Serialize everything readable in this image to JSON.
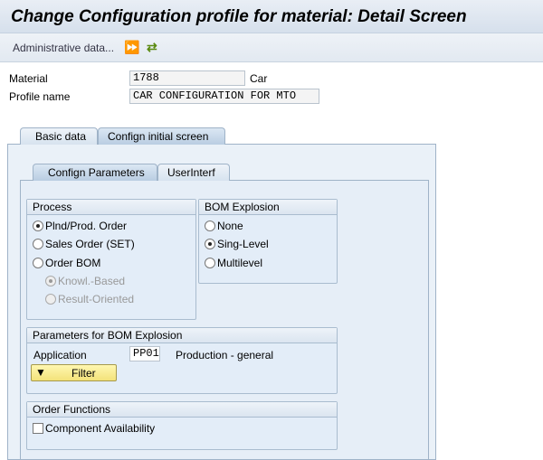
{
  "title": "Change Configuration profile for material: Detail Screen",
  "toolbar": {
    "admin_label": "Administrative data...",
    "icons": [
      "execute-icon",
      "switch-icon"
    ]
  },
  "header": {
    "material_label": "Material",
    "material_value": "1788",
    "material_desc": "Car",
    "profile_label": "Profile name",
    "profile_value": "CAR CONFIGURATION FOR MTO"
  },
  "tabs": [
    {
      "label": "Basic data",
      "active": false
    },
    {
      "label": "Confign initial screen",
      "active": true
    }
  ],
  "subtabs": [
    {
      "label": "Confign Parameters",
      "active": true
    },
    {
      "label": "UserInterf",
      "active": false
    }
  ],
  "process": {
    "title": "Process",
    "options": [
      {
        "label": "Plnd/Prod. Order",
        "selected": true
      },
      {
        "label": "Sales Order (SET)",
        "selected": false
      },
      {
        "label": "Order BOM",
        "selected": false
      },
      {
        "label": "Knowl.-Based",
        "selected": true,
        "disabled": true
      },
      {
        "label": "Result-Oriented",
        "selected": false,
        "disabled": true
      }
    ]
  },
  "bom": {
    "title": "BOM Explosion",
    "options": [
      {
        "label": "None",
        "selected": false
      },
      {
        "label": "Sing-Level",
        "selected": true
      },
      {
        "label": "Multilevel",
        "selected": false
      }
    ]
  },
  "params": {
    "title": "Parameters for BOM Explosion",
    "application_label": "Application",
    "application_value": "PP01",
    "application_desc": "Production - general",
    "filter_label": "Filter"
  },
  "order": {
    "title": "Order Functions",
    "component_label": "Component Availability",
    "component_checked": false
  }
}
